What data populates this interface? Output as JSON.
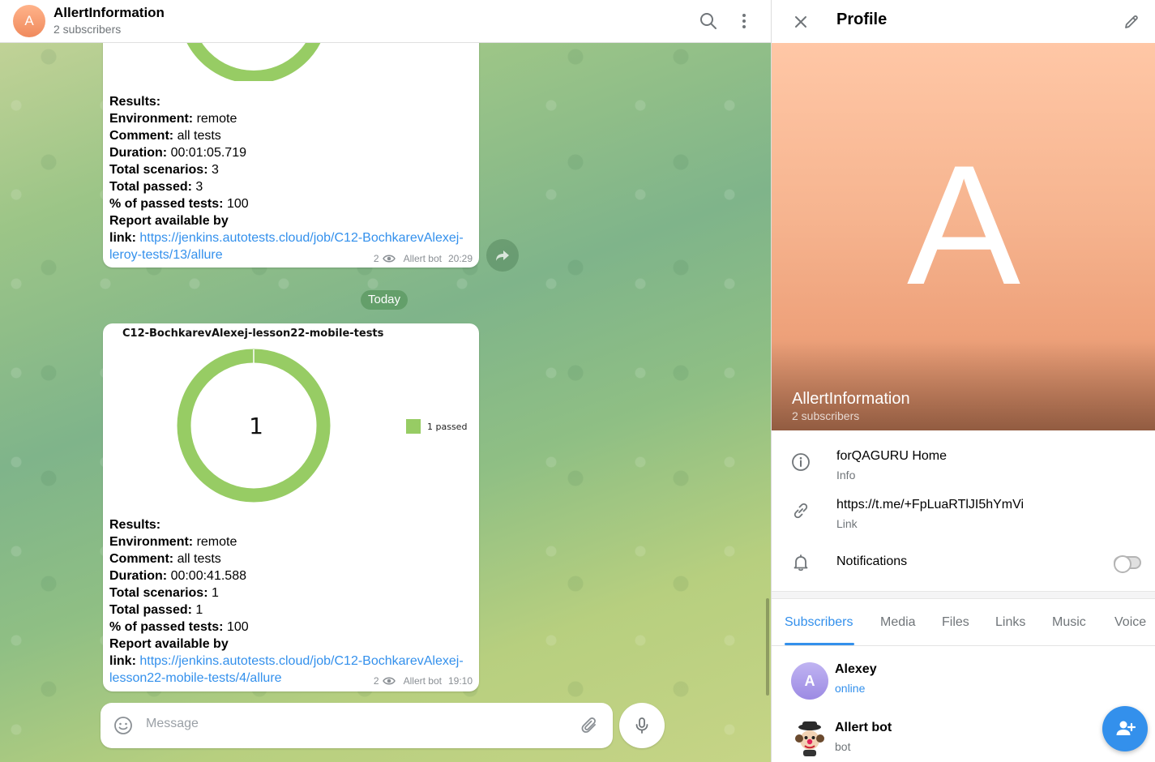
{
  "chat": {
    "title": "AllertInformation",
    "subtitle": "2 subscribers",
    "avatar_letter": "A",
    "search_icon": "search-icon",
    "menu_icon": "more-vertical-icon"
  },
  "messages": [
    {
      "fields": [
        {
          "label": "Results:",
          "value": ""
        },
        {
          "label": "Environment:",
          "value": "remote"
        },
        {
          "label": "Comment:",
          "value": "all tests"
        },
        {
          "label": "Duration:",
          "value": "00:01:05.719"
        },
        {
          "label": "Total scenarios:",
          "value": "3"
        },
        {
          "label": "Total passed:",
          "value": "3"
        },
        {
          "label": "% of passed tests:",
          "value": "100"
        },
        {
          "label": "Report available by",
          "value": ""
        }
      ],
      "link_label": "link:",
      "link": "https://jenkins.autotests.cloud/job/C12-BochkarevAlexej-leroy-tests/13/allure",
      "link_line1": "https://jenkins.autotests.cloud/job/C12-BochkarevAlexej-",
      "link_line2": "leroy-tests/13/allure",
      "views": "2",
      "author": "Allert bot",
      "time": "20:29"
    },
    {
      "chart_title": "C12-BochkarevAlexej-lesson22-mobile-tests",
      "chart_center": "1",
      "legend_label": "1 passed",
      "fields": [
        {
          "label": "Results:",
          "value": ""
        },
        {
          "label": "Environment:",
          "value": "remote"
        },
        {
          "label": "Comment:",
          "value": "all tests"
        },
        {
          "label": "Duration:",
          "value": "00:00:41.588"
        },
        {
          "label": "Total scenarios:",
          "value": "1"
        },
        {
          "label": "Total passed:",
          "value": "1"
        },
        {
          "label": "% of passed tests:",
          "value": "100"
        },
        {
          "label": "Report available by",
          "value": ""
        }
      ],
      "link_label": "link:",
      "link": "https://jenkins.autotests.cloud/job/C12-BochkarevAlexej-lesson22-mobile-tests/4/allure",
      "link_line1": "https://jenkins.autotests.cloud/job/C12-BochkarevAlexej-",
      "link_line2": "lesson22-mobile-tests/4/allure",
      "views": "2",
      "author": "Allert bot",
      "time": "19:10"
    }
  ],
  "date_separator": "Today",
  "composer": {
    "placeholder": "Message",
    "emoji_icon": "smile-icon",
    "attach_icon": "paperclip-icon",
    "mic_icon": "microphone-icon"
  },
  "profile": {
    "title": "Profile",
    "close_icon": "close-icon",
    "edit_icon": "pencil-icon",
    "cover_letter": "A",
    "name": "AllertInformation",
    "subtitle": "2 subscribers",
    "info": [
      {
        "main": "forQAGURU Home",
        "sub": "Info",
        "icon": "info-icon"
      },
      {
        "main": "https://t.me/+FpLuaRTlJI5hYmVi",
        "sub": "Link",
        "icon": "link-icon"
      },
      {
        "main": "Notifications",
        "sub": "",
        "icon": "bell-icon"
      }
    ],
    "notifications_enabled": false,
    "tabs": [
      "Subscribers",
      "Media",
      "Files",
      "Links",
      "Music",
      "Voice"
    ],
    "active_tab": "Subscribers",
    "members": [
      {
        "name": "Alexey",
        "status": "online",
        "avatar_letter": "A"
      },
      {
        "name": "Allert bot",
        "status": "bot",
        "avatar_letter": ""
      }
    ],
    "add_member_icon": "add-user-icon"
  },
  "colors": {
    "accent": "#3390ec",
    "pass_green": "#97cc64",
    "avatar_orange": "#f08a5d",
    "avatar_purple": "#a695e7"
  }
}
